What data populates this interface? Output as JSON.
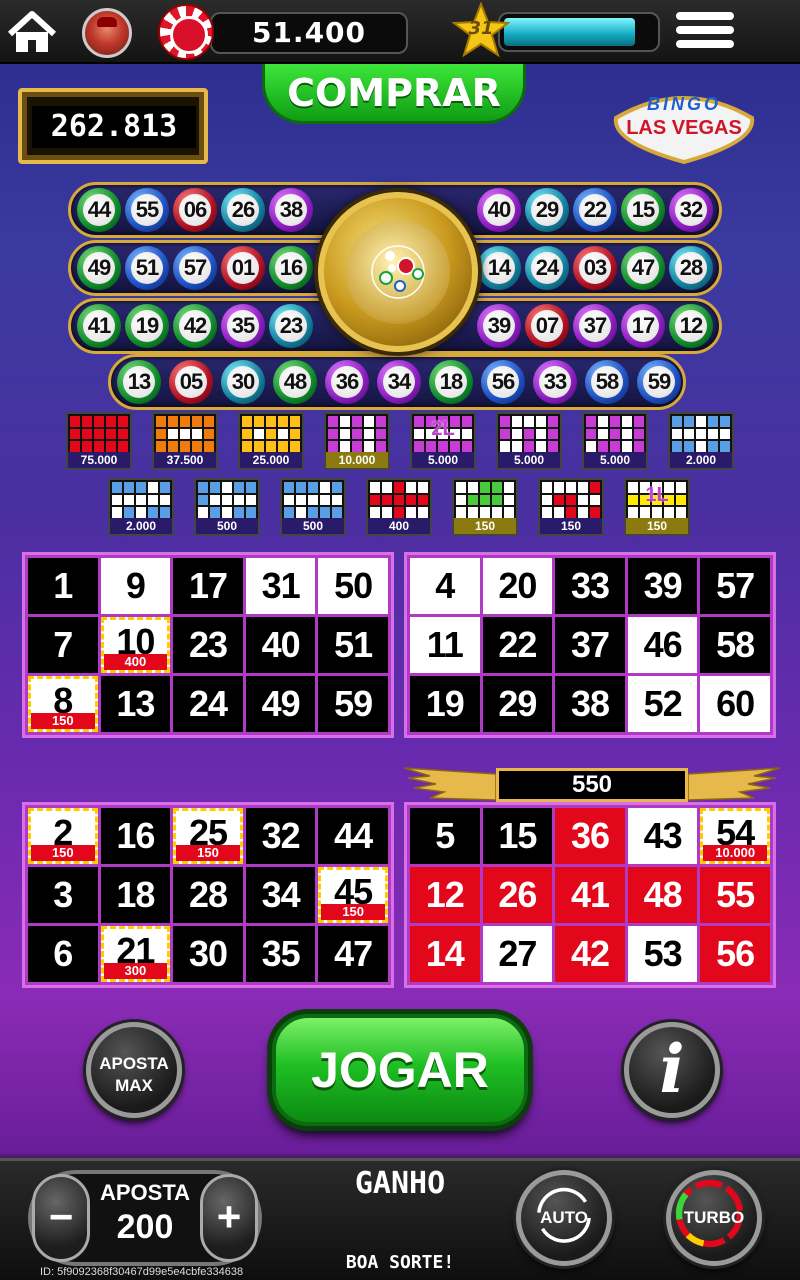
{
  "topbar": {
    "balance": "51.400",
    "level": "31",
    "xp_progress": 0.87
  },
  "comprar_label": "COMPRAR",
  "jackpot": "262.813",
  "logo": {
    "line1": "BINGO",
    "line2": "LAS VEGAS"
  },
  "balls": {
    "row1_left": [
      {
        "n": "44",
        "c": "b-green"
      },
      {
        "n": "55",
        "c": "b-blue"
      },
      {
        "n": "06",
        "c": "b-red"
      },
      {
        "n": "26",
        "c": "b-teal"
      },
      {
        "n": "38",
        "c": "b-purple"
      }
    ],
    "row1_right": [
      {
        "n": "40",
        "c": "b-purple"
      },
      {
        "n": "29",
        "c": "b-teal"
      },
      {
        "n": "22",
        "c": "b-blue"
      },
      {
        "n": "15",
        "c": "b-green"
      },
      {
        "n": "32",
        "c": "b-purple"
      }
    ],
    "row2_left": [
      {
        "n": "49",
        "c": "b-green"
      },
      {
        "n": "51",
        "c": "b-blue"
      },
      {
        "n": "57",
        "c": "b-blue"
      },
      {
        "n": "01",
        "c": "b-red"
      },
      {
        "n": "16",
        "c": "b-green"
      }
    ],
    "row2_right": [
      {
        "n": "14",
        "c": "b-teal"
      },
      {
        "n": "24",
        "c": "b-teal"
      },
      {
        "n": "03",
        "c": "b-red"
      },
      {
        "n": "47",
        "c": "b-green"
      },
      {
        "n": "28",
        "c": "b-teal"
      }
    ],
    "row3_left": [
      {
        "n": "41",
        "c": "b-green"
      },
      {
        "n": "19",
        "c": "b-green"
      },
      {
        "n": "42",
        "c": "b-green"
      },
      {
        "n": "35",
        "c": "b-purple"
      },
      {
        "n": "23",
        "c": "b-teal"
      }
    ],
    "row3_right": [
      {
        "n": "39",
        "c": "b-purple"
      },
      {
        "n": "07",
        "c": "b-red"
      },
      {
        "n": "37",
        "c": "b-purple"
      },
      {
        "n": "17",
        "c": "b-purple"
      },
      {
        "n": "12",
        "c": "b-green"
      }
    ],
    "row4": [
      {
        "n": "13",
        "c": "b-green"
      },
      {
        "n": "05",
        "c": "b-red"
      },
      {
        "n": "30",
        "c": "b-teal"
      },
      {
        "n": "48",
        "c": "b-green"
      },
      {
        "n": "36",
        "c": "b-purple"
      },
      {
        "n": "34",
        "c": "b-purple"
      },
      {
        "n": "18",
        "c": "b-green"
      },
      {
        "n": "56",
        "c": "b-blue"
      },
      {
        "n": "33",
        "c": "b-purple"
      },
      {
        "n": "58",
        "c": "b-blue"
      },
      {
        "n": "59",
        "c": "b-blue"
      }
    ]
  },
  "patterns": [
    {
      "prize": "75.000",
      "color": "#e3071b",
      "fill": "111111111111111",
      "tag": ""
    },
    {
      "prize": "37.500",
      "color": "#f07d0b",
      "fill": "111111000111111",
      "tag": ""
    },
    {
      "prize": "25.000",
      "color": "#ffbf17",
      "fill": "111111010111111",
      "tag": ""
    },
    {
      "prize": "10.000",
      "color": "#c83cd6",
      "fill": "101011010110101",
      "tag": "",
      "gold": true
    },
    {
      "prize": "5.000",
      "color": "#c83cd6",
      "fill": "111110000011111",
      "tag": "2L"
    },
    {
      "prize": "5.000",
      "color": "#c83cd6",
      "fill": "100011010100101",
      "tag": ""
    },
    {
      "prize": "5.000",
      "color": "#c83cd6",
      "fill": "101011010101101",
      "tag": ""
    },
    {
      "prize": "2.000",
      "color": "#5a9ee6",
      "fill": "110110000011011",
      "tag": ""
    },
    {
      "prize": "2.000",
      "color": "#5a9ee6",
      "fill": "111010000001011",
      "tag": ""
    },
    {
      "prize": "500",
      "color": "#5a9ee6",
      "fill": "110111000001011",
      "tag": ""
    },
    {
      "prize": "500",
      "color": "#5a9ee6",
      "fill": "111010000010111",
      "tag": ""
    },
    {
      "prize": "400",
      "color": "#e3071b",
      "fill": "001001111100100",
      "tag": ""
    },
    {
      "prize": "150",
      "color": "#49c93c",
      "fill": "001100111000000",
      "tag": "",
      "gold": true
    },
    {
      "prize": "150",
      "color": "#e3071b",
      "fill": "000010110000101",
      "tag": ""
    },
    {
      "prize": "150",
      "color": "#ffea00",
      "fill": "000001111100000",
      "tag": "1L",
      "gold": true
    }
  ],
  "cards": [
    {
      "cells": [
        {
          "n": "1",
          "t": ""
        },
        {
          "n": "9",
          "t": "w"
        },
        {
          "n": "17",
          "t": ""
        },
        {
          "n": "31",
          "t": "w"
        },
        {
          "n": "50",
          "t": "w"
        },
        {
          "n": "7",
          "t": ""
        },
        {
          "n": "10",
          "t": "p",
          "pz": "400"
        },
        {
          "n": "23",
          "t": ""
        },
        {
          "n": "40",
          "t": ""
        },
        {
          "n": "51",
          "t": ""
        },
        {
          "n": "8",
          "t": "p",
          "pz": "150"
        },
        {
          "n": "13",
          "t": ""
        },
        {
          "n": "24",
          "t": ""
        },
        {
          "n": "49",
          "t": ""
        },
        {
          "n": "59",
          "t": ""
        }
      ]
    },
    {
      "cells": [
        {
          "n": "4",
          "t": "w"
        },
        {
          "n": "20",
          "t": "w"
        },
        {
          "n": "33",
          "t": ""
        },
        {
          "n": "39",
          "t": ""
        },
        {
          "n": "57",
          "t": ""
        },
        {
          "n": "11",
          "t": "w"
        },
        {
          "n": "22",
          "t": ""
        },
        {
          "n": "37",
          "t": ""
        },
        {
          "n": "46",
          "t": "w"
        },
        {
          "n": "58",
          "t": ""
        },
        {
          "n": "19",
          "t": ""
        },
        {
          "n": "29",
          "t": ""
        },
        {
          "n": "38",
          "t": ""
        },
        {
          "n": "52",
          "t": "w"
        },
        {
          "n": "60",
          "t": "w"
        }
      ]
    },
    {
      "cells": [
        {
          "n": "2",
          "t": "p",
          "pz": "150"
        },
        {
          "n": "16",
          "t": ""
        },
        {
          "n": "25",
          "t": "p",
          "pz": "150"
        },
        {
          "n": "32",
          "t": ""
        },
        {
          "n": "44",
          "t": ""
        },
        {
          "n": "3",
          "t": ""
        },
        {
          "n": "18",
          "t": ""
        },
        {
          "n": "28",
          "t": ""
        },
        {
          "n": "34",
          "t": ""
        },
        {
          "n": "45",
          "t": "p",
          "pz": "150"
        },
        {
          "n": "6",
          "t": ""
        },
        {
          "n": "21",
          "t": "p",
          "pz": "300"
        },
        {
          "n": "30",
          "t": ""
        },
        {
          "n": "35",
          "t": ""
        },
        {
          "n": "47",
          "t": ""
        }
      ]
    },
    {
      "cells": [
        {
          "n": "5",
          "t": ""
        },
        {
          "n": "15",
          "t": ""
        },
        {
          "n": "36",
          "t": "r"
        },
        {
          "n": "43",
          "t": "w"
        },
        {
          "n": "54",
          "t": "p",
          "pz": "10.000"
        },
        {
          "n": "12",
          "t": "r"
        },
        {
          "n": "26",
          "t": "r"
        },
        {
          "n": "41",
          "t": "r"
        },
        {
          "n": "48",
          "t": "r"
        },
        {
          "n": "55",
          "t": "r"
        },
        {
          "n": "14",
          "t": "r"
        },
        {
          "n": "27",
          "t": "w"
        },
        {
          "n": "42",
          "t": "r"
        },
        {
          "n": "53",
          "t": "w"
        },
        {
          "n": "56",
          "t": "r"
        }
      ]
    }
  ],
  "card4_win": "550",
  "buttons": {
    "max_bet_line1": "APOSTA",
    "max_bet_line2": "MAX",
    "play": "JOGAR",
    "info": "i",
    "auto": "AUTO",
    "turbo": "TURBO",
    "minus": "−",
    "plus": "+"
  },
  "bottom": {
    "bet_label": "APOSTA",
    "bet_value": "200",
    "win_label": "GANHO",
    "good_luck": "BOA SORTE!",
    "session_id": "ID: 5f9092368f30467d99e5e4cbfe334638"
  }
}
